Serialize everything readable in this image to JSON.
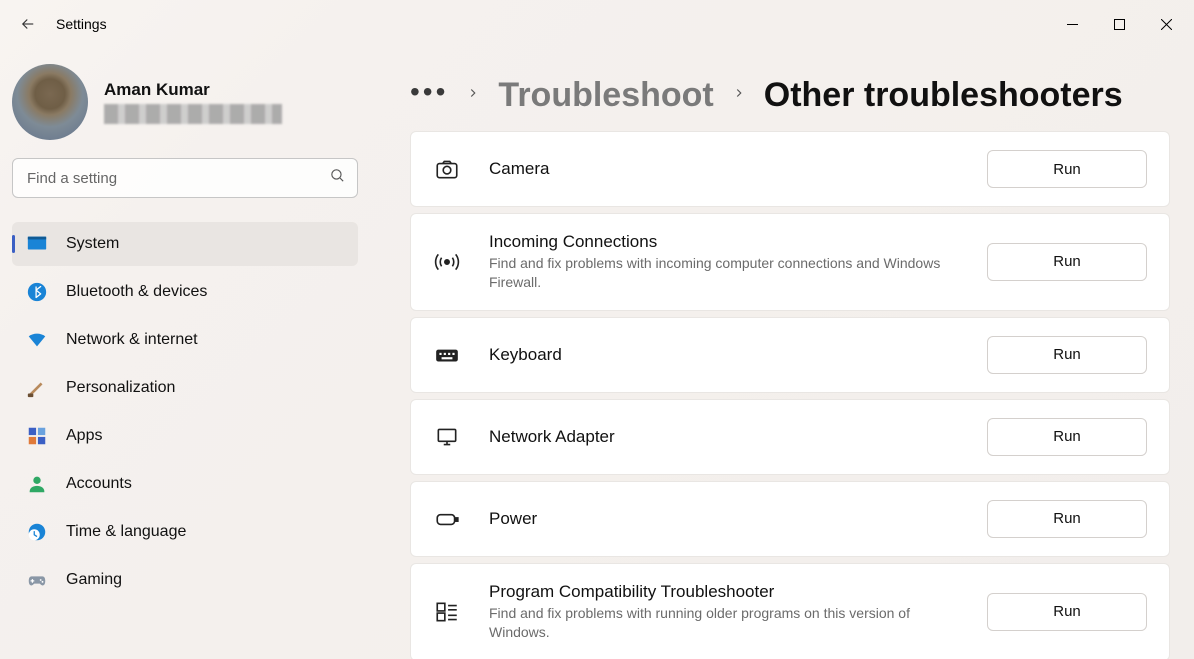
{
  "titlebar": {
    "back": "←",
    "title": "Settings"
  },
  "user": {
    "name": "Aman Kumar"
  },
  "search": {
    "placeholder": "Find a setting"
  },
  "nav": {
    "items": [
      {
        "label": "System"
      },
      {
        "label": "Bluetooth & devices"
      },
      {
        "label": "Network & internet"
      },
      {
        "label": "Personalization"
      },
      {
        "label": "Apps"
      },
      {
        "label": "Accounts"
      },
      {
        "label": "Time & language"
      },
      {
        "label": "Gaming"
      }
    ]
  },
  "breadcrumb": {
    "dots": "•••",
    "parent": "Troubleshoot",
    "current": "Other troubleshooters"
  },
  "run_label": "Run",
  "items": [
    {
      "title": "Camera",
      "desc": ""
    },
    {
      "title": "Incoming Connections",
      "desc": "Find and fix problems with incoming computer connections and Windows Firewall."
    },
    {
      "title": "Keyboard",
      "desc": ""
    },
    {
      "title": "Network Adapter",
      "desc": ""
    },
    {
      "title": "Power",
      "desc": ""
    },
    {
      "title": "Program Compatibility Troubleshooter",
      "desc": "Find and fix problems with running older programs on this version of Windows."
    }
  ]
}
